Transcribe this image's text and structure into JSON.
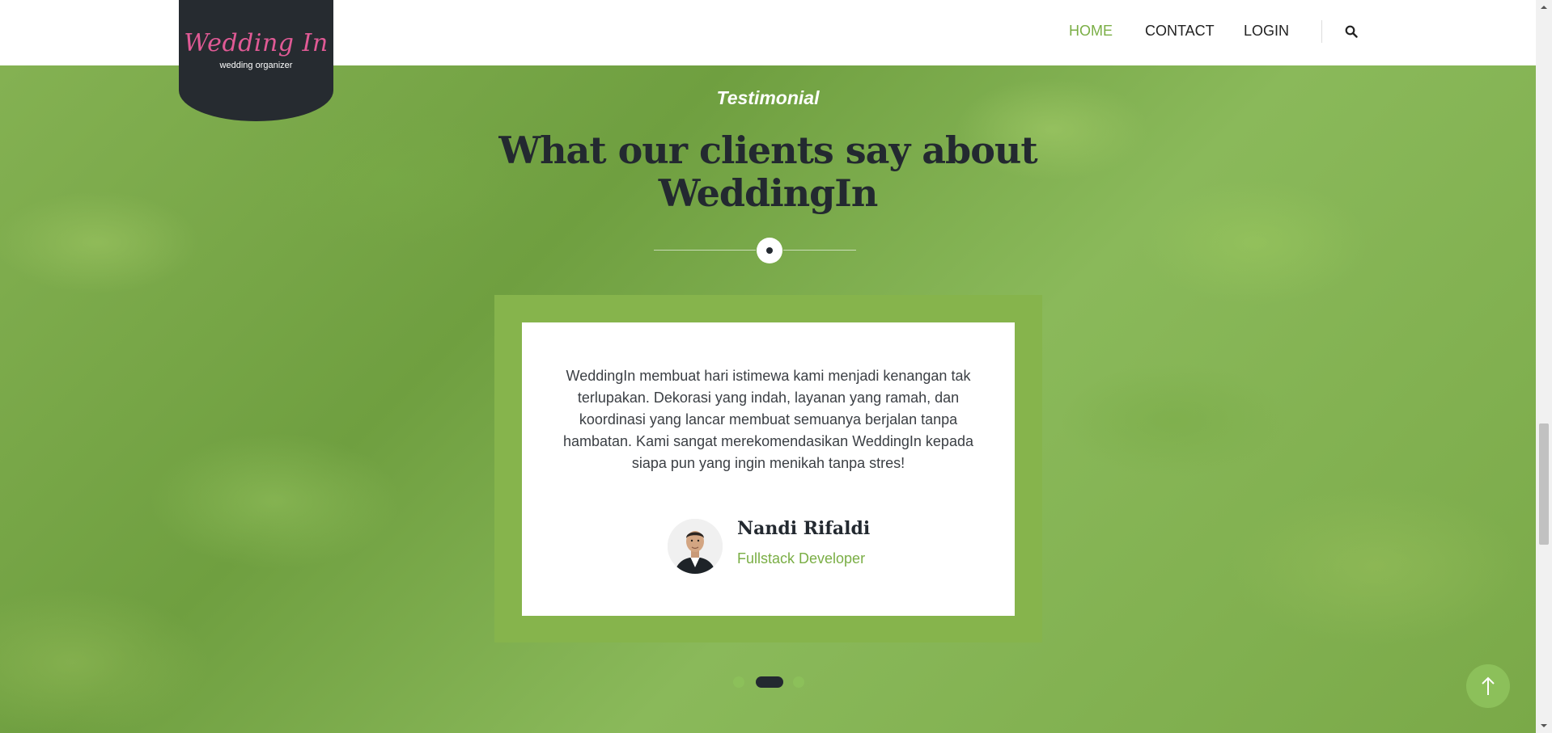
{
  "header": {
    "logo_title": "Wedding In",
    "logo_subtitle": "wedding organizer",
    "nav": [
      {
        "label": "HOME"
      },
      {
        "label": "CONTACT"
      },
      {
        "label": "LOGIN"
      }
    ],
    "search_icon": "search-icon"
  },
  "section": {
    "eyebrow": "Testimonial",
    "title": "What our clients say about WeddingIn"
  },
  "testimonial": {
    "quote": "WeddingIn membuat hari istimewa kami menjadi kenangan tak terlupakan. Dekorasi yang indah, layanan yang ramah, dan koordinasi yang lancar membuat semuanya berjalan tanpa hambatan. Kami sangat merekomendasikan WeddingIn kepada siapa pun yang ingin menikah tanpa stres!",
    "name": "Nandi Rifaldi",
    "role": "Fullstack Developer",
    "avatar_icon": "person-avatar"
  },
  "carousel": {
    "total": 3,
    "active": 2
  },
  "back_to_top_icon": "arrow-up-icon",
  "colors": {
    "accent": "#7aae45",
    "dark": "#232930",
    "logo_pink": "#e05a95",
    "card_frame": "#86b44c"
  }
}
